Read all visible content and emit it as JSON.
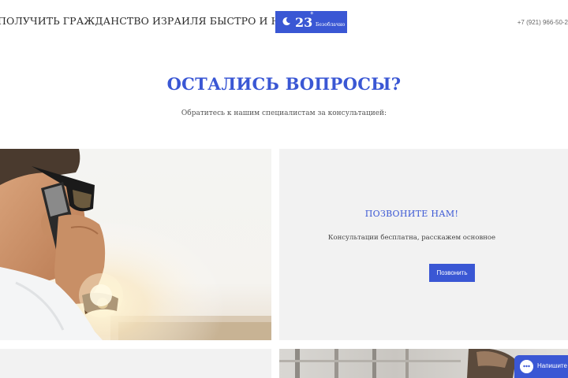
{
  "header": {
    "tagline": "ПОЛУЧИТЬ ГРАЖДАНСТВО ИЗРАИЛЯ БЫСТРО И НЕ ДОРОГО!",
    "weather": {
      "icon": "moon-icon",
      "temperature": "23",
      "degree": "°",
      "condition": "Безоблачно"
    },
    "phone": "+7 (921) 966-50-2"
  },
  "questions": {
    "title": "ОСТАЛИСЬ ВОПРОСЫ?",
    "subtitle": "Обратитесь к нашим специалистам за консультацией:"
  },
  "call_panel": {
    "title": "ПОЗВОНИТЕ НАМ!",
    "subtitle": "Консультации бесплатна, расскажем основное",
    "button_label": "Позвонить"
  },
  "chat_widget": {
    "icon": "chat-icon",
    "label": "Напишите"
  },
  "colors": {
    "accent": "#3a57d4",
    "panel_bg": "#f2f2f2",
    "text": "#333333"
  }
}
